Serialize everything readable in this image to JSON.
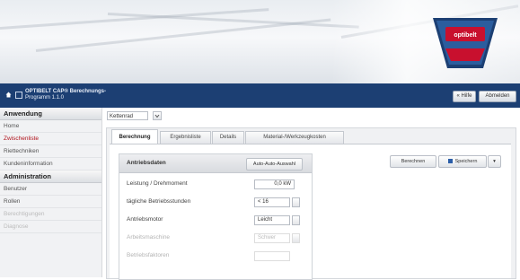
{
  "brand": {
    "logo_text": "optibelt",
    "accent": "#1c3f73",
    "logo_red": "#c8102e"
  },
  "topbar": {
    "title_line1": "OPTIBELT CAP® Berechnungs-",
    "title_line2": "Programm 1.1.0",
    "btn_hilfe": "« Hilfe",
    "btn_abmelden": "Abmelden"
  },
  "sidebar": {
    "section1": "Anwendung",
    "items1": [
      "Home",
      "Zwischenliste",
      "Riettechniken",
      "Kundeninformation"
    ],
    "section2": "Administration",
    "items2": [
      "Benutzer",
      "Rollen",
      "Berechtigungen",
      "Diagnose"
    ]
  },
  "main": {
    "select_value": "Kettenrad",
    "tabs": [
      "Berechnung",
      "Ergebnisliste",
      "Details",
      "Material-/Werkzeugkosten"
    ],
    "box": {
      "title": "Antriebsdaten",
      "head_button": "Auto-Auto-Auswahl",
      "rows": [
        {
          "label": "Leistung / Drehmoment",
          "value": "0,0 kW"
        },
        {
          "label": "tägliche Betriebsstunden",
          "value": "< 16"
        },
        {
          "label": "Antriebsmotor",
          "value": "Leicht"
        },
        {
          "label": "Arbeitsmaschine",
          "value": "Schwer"
        },
        {
          "label": "Betriebsfaktoren",
          "value": ""
        }
      ]
    },
    "actions": {
      "berechnen": "Berechnen",
      "speichern": "Speichern",
      "more": "▾"
    }
  }
}
